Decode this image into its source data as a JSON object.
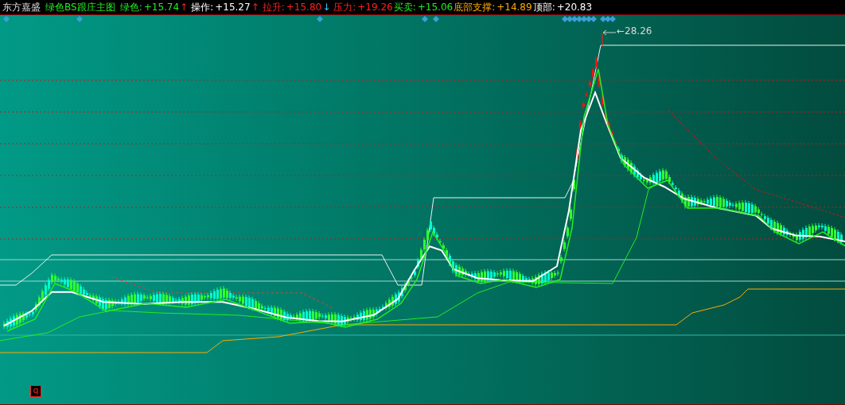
{
  "header": {
    "app_title": "东方嘉盛",
    "indicator_name": "绿色BS跟庄主图",
    "series": [
      {
        "label": "绿色:",
        "value": "+15.74",
        "arrow": "↑"
      },
      {
        "label": "操作:",
        "value": "+15.27",
        "arrow": "↑"
      },
      {
        "label": "拉升:",
        "value": "+15.80",
        "arrow": "↓"
      },
      {
        "label": "压力:",
        "value": "+19.26"
      },
      {
        "label": "买卖:",
        "value": "+15.06"
      },
      {
        "label": "底部支撑:",
        "value": "+14.89"
      },
      {
        "label": "顶部:",
        "value": "+20.83"
      }
    ]
  },
  "chart": {
    "peak_label": "←28.26",
    "corner_button": "q"
  }
}
